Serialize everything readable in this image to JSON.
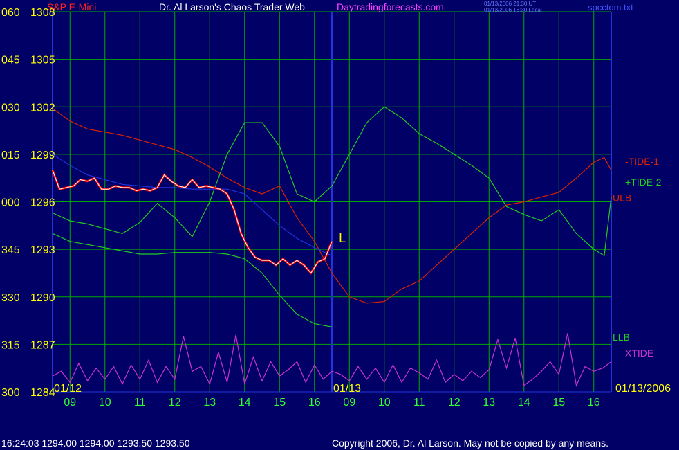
{
  "header": {
    "instrument": "S&P E-Mini",
    "title": "Dr. Al Larson's Chaos Trader Web",
    "site": "Daytradingforecasts.com",
    "timestamp_ut": "01/13/2006 21:30 UT",
    "timestamp_local": "01/13/2006 16:30 Local",
    "filename": "spcctom.txt"
  },
  "footer": {
    "quote": "16:24:03  1294.00 1294.00 1293.50 1293.50",
    "copyright": "Copyright 2006, Dr. Al Larson. May not be copied by any means."
  },
  "colors": {
    "background": "#000066",
    "grid": "#00aa00",
    "price_red": "#ff0000",
    "price_white": "#ffffff",
    "tide1": "#dd2200",
    "tide2": "#22cc22",
    "xtide": "#cc33cc",
    "blue": "#2233dd",
    "yellow_label": "#ffff00",
    "green_label": "#33ff33"
  },
  "chart_data": {
    "type": "line",
    "y_axis": {
      "ticks": [
        {
          "deg": "060",
          "price": 1308
        },
        {
          "deg": "045",
          "price": 1305
        },
        {
          "deg": "030",
          "price": 1302
        },
        {
          "deg": "015",
          "price": 1299
        },
        {
          "deg": "000",
          "price": 1296
        },
        {
          "deg": "345",
          "price": 1293
        },
        {
          "deg": "330",
          "price": 1290
        },
        {
          "deg": "315",
          "price": 1287
        },
        {
          "deg": "300",
          "price": 1284
        }
      ],
      "ylim": [
        1284,
        1308
      ]
    },
    "x_axis": {
      "ticks": [
        "09",
        "10",
        "11",
        "12",
        "13",
        "14",
        "15",
        "16",
        "09",
        "10",
        "11",
        "12",
        "13",
        "14",
        "15",
        "16"
      ],
      "date_labels": [
        "01/12",
        "01/13",
        "01/13/2006"
      ],
      "xlim": [
        0,
        16
      ]
    },
    "grid": true,
    "series": [
      {
        "name": "-TIDE-1",
        "x": [
          0,
          0.5,
          1,
          1.5,
          2,
          2.5,
          3,
          3.5,
          4,
          4.5,
          5,
          5.5,
          6,
          6.5,
          7,
          7.5,
          8,
          8.5,
          9,
          9.5,
          10,
          10.5,
          11,
          11.5,
          12,
          12.5,
          13,
          13.5,
          14,
          14.5,
          15,
          15.5,
          15.8,
          16
        ],
        "values": [
          1301.9,
          1301.1,
          1300.6,
          1300.4,
          1300.2,
          1299.9,
          1299.6,
          1299.3,
          1298.8,
          1298.2,
          1297.5,
          1296.9,
          1296.5,
          1297.0,
          1295.0,
          1293.5,
          1291.5,
          1290.0,
          1289.6,
          1289.7,
          1290.5,
          1291.0,
          1292.0,
          1293.0,
          1294.0,
          1295.0,
          1295.8,
          1296.0,
          1296.3,
          1296.6,
          1297.5,
          1298.5,
          1298.8,
          1298.0
        ]
      },
      {
        "name": "+TIDE-2",
        "x": [
          0,
          0.5,
          1,
          1.5,
          2,
          2.5,
          3,
          3.5,
          4,
          4.5,
          5,
          5.5,
          6,
          6.5,
          7,
          7.5,
          8,
          8.5,
          9,
          9.5,
          10,
          10.5,
          11,
          11.5,
          12,
          12.5,
          13,
          13.5,
          14,
          14.5,
          15,
          15.5,
          15.8,
          16
        ],
        "values": [
          1295.3,
          1294.8,
          1294.6,
          1294.3,
          1294.0,
          1294.7,
          1295.9,
          1295.0,
          1293.8,
          1296.0,
          1299.0,
          1301.0,
          1301.0,
          1299.5,
          1296.5,
          1296.0,
          1297.0,
          1299.0,
          1301.0,
          1302.0,
          1301.3,
          1300.3,
          1299.7,
          1299.0,
          1298.3,
          1297.5,
          1295.7,
          1295.2,
          1294.8,
          1295.5,
          1294.0,
          1293.0,
          1292.6,
          1296.3
        ]
      },
      {
        "name": "ULB",
        "x": [
          0,
          0.5,
          1,
          1.5,
          2,
          2.5,
          3,
          3.5,
          4,
          4.5,
          5,
          5.5,
          6,
          6.5,
          7,
          7.5,
          8
        ],
        "values": [
          1299.0,
          1298.3,
          1297.7,
          1297.4,
          1297.1,
          1297.0,
          1296.9,
          1296.9,
          1296.8,
          1296.8,
          1296.8,
          1296.5,
          1295.5,
          1294.5,
          1293.7,
          1293.1,
          1292.6
        ]
      },
      {
        "name": "LLB",
        "x": [
          0,
          0.5,
          1,
          1.5,
          2,
          2.5,
          3,
          3.5,
          4,
          4.5,
          5,
          5.5,
          6,
          6.5,
          7,
          7.5,
          8
        ],
        "values": [
          1294.0,
          1293.5,
          1293.3,
          1293.1,
          1292.9,
          1292.7,
          1292.7,
          1292.8,
          1292.8,
          1292.8,
          1292.7,
          1292.4,
          1291.5,
          1290.1,
          1288.9,
          1288.3,
          1288.1
        ]
      },
      {
        "name": "S&P E-Mini",
        "x": [
          0,
          0.2,
          0.4,
          0.6,
          0.8,
          1.0,
          1.2,
          1.4,
          1.6,
          1.8,
          2.0,
          2.2,
          2.4,
          2.6,
          2.8,
          3.0,
          3.2,
          3.4,
          3.6,
          3.8,
          4.0,
          4.2,
          4.4,
          4.6,
          4.8,
          5.0,
          5.2,
          5.4,
          5.6,
          5.8,
          6.0,
          6.2,
          6.4,
          6.6,
          6.8,
          7.0,
          7.2,
          7.4,
          7.6,
          7.8,
          8.0
        ],
        "values": [
          1298.0,
          1296.8,
          1296.9,
          1297.0,
          1297.4,
          1297.3,
          1297.5,
          1296.8,
          1296.8,
          1297.0,
          1296.9,
          1296.9,
          1296.7,
          1296.8,
          1296.7,
          1296.9,
          1297.7,
          1297.3,
          1297.0,
          1296.9,
          1297.4,
          1296.9,
          1297.0,
          1296.9,
          1296.8,
          1296.5,
          1295.5,
          1294.0,
          1293.1,
          1292.5,
          1292.3,
          1292.3,
          1292.0,
          1292.4,
          1292.0,
          1292.3,
          1292.0,
          1291.5,
          1292.2,
          1292.4,
          1293.5
        ]
      },
      {
        "name": "XTIDE",
        "x": [
          0,
          0.25,
          0.5,
          0.75,
          1,
          1.25,
          1.5,
          1.75,
          2,
          2.25,
          2.5,
          2.75,
          3,
          3.25,
          3.5,
          3.75,
          4,
          4.25,
          4.5,
          4.75,
          5,
          5.25,
          5.5,
          5.75,
          6,
          6.25,
          6.5,
          6.75,
          7,
          7.25,
          7.5,
          7.75,
          8,
          8.25,
          8.5,
          8.75,
          9,
          9.25,
          9.5,
          9.75,
          10,
          10.25,
          10.5,
          10.75,
          11,
          11.25,
          11.5,
          11.75,
          12,
          12.25,
          12.5,
          12.75,
          13,
          13.25,
          13.5,
          13.75,
          14,
          14.25,
          14.5,
          14.75,
          15,
          15.25,
          15.5,
          15.75,
          16
        ],
        "values": [
          1285.0,
          1285.3,
          1284.6,
          1285.8,
          1284.7,
          1285.5,
          1284.8,
          1285.6,
          1284.5,
          1285.7,
          1284.8,
          1286.0,
          1284.6,
          1285.6,
          1284.8,
          1287.5,
          1285.3,
          1285.6,
          1284.5,
          1286.5,
          1284.6,
          1287.6,
          1284.5,
          1286.2,
          1284.7,
          1285.9,
          1285.0,
          1285.4,
          1285.9,
          1284.6,
          1285.7,
          1284.8,
          1285.3,
          1285.1,
          1284.7,
          1285.6,
          1284.8,
          1285.5,
          1284.6,
          1285.7,
          1284.6,
          1285.5,
          1285.2,
          1284.8,
          1286.0,
          1284.6,
          1285.1,
          1284.7,
          1285.3,
          1284.9,
          1285.4,
          1287.3,
          1285.5,
          1287.4,
          1284.4,
          1284.8,
          1285.3,
          1285.9,
          1285.1,
          1287.7,
          1284.4,
          1285.6,
          1285.3,
          1285.5,
          1285.9
        ]
      }
    ],
    "annotations": [
      {
        "text": "L",
        "x": 8.2,
        "y": 1293.7,
        "color": "#ffff00"
      }
    ],
    "series_labels": [
      {
        "text": "-TIDE-1",
        "color": "#dd2200",
        "y": 1298.6
      },
      {
        "text": "ULB",
        "color": "#dd2200",
        "y": 1296.3
      },
      {
        "text": "+TIDE-2",
        "color": "#22cc22",
        "y": 1297.3
      },
      {
        "text": "LLB",
        "color": "#22cc22",
        "y": 1287.5
      },
      {
        "text": "XTIDE",
        "color": "#cc33cc",
        "y": 1286.5
      }
    ]
  }
}
